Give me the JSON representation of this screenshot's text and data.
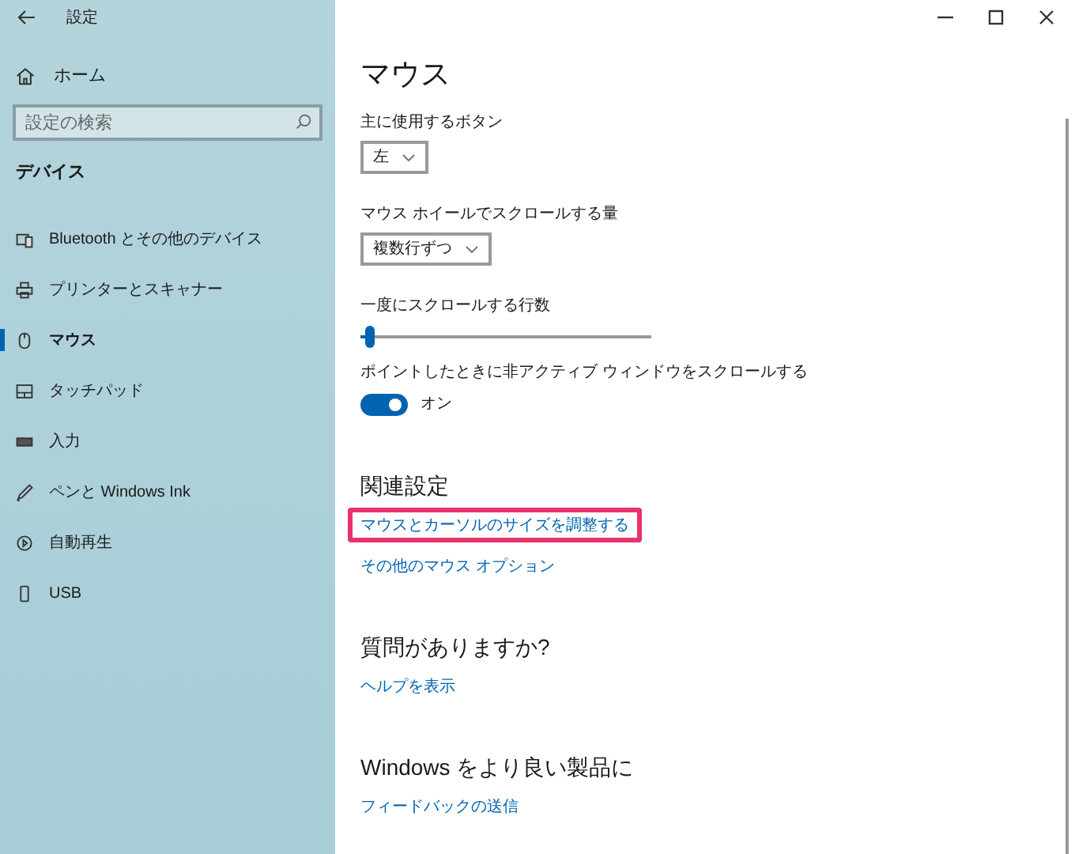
{
  "window": {
    "title": "設定"
  },
  "sidebar": {
    "home": "ホーム",
    "search": {
      "placeholder": "設定の検索"
    },
    "section": "デバイス",
    "items": [
      {
        "label": "Bluetooth とその他のデバイス",
        "kind": "bluetooth",
        "selected": false
      },
      {
        "label": "プリンターとスキャナー",
        "kind": "printer",
        "selected": false
      },
      {
        "label": "マウス",
        "kind": "mouse",
        "selected": true
      },
      {
        "label": "タッチパッド",
        "kind": "touchpad",
        "selected": false
      },
      {
        "label": "入力",
        "kind": "keyboard",
        "selected": false
      },
      {
        "label": "ペンと Windows Ink",
        "kind": "pen",
        "selected": false
      },
      {
        "label": "自動再生",
        "kind": "autoplay",
        "selected": false
      },
      {
        "label": "USB",
        "kind": "usb",
        "selected": false
      }
    ]
  },
  "main": {
    "title": "マウス",
    "settings": [
      {
        "kind": "dropdown",
        "label": "主に使用するボタン",
        "value": "左"
      },
      {
        "kind": "dropdown",
        "label": "マウス ホイールでスクロールする量",
        "value": "複数行ずつ"
      },
      {
        "kind": "slider",
        "label": "一度にスクロールする行数",
        "level": 0.03
      },
      {
        "kind": "toggle",
        "label": "ポイントしたときに非アクティブ ウィンドウをスクロールする",
        "on": true,
        "state_text": "オン"
      }
    ],
    "sections": [
      {
        "heading": "関連設定",
        "links": [
          {
            "label": "マウスとカーソルのサイズを調整する",
            "highlighted": true
          },
          {
            "label": "その他のマウス オプション",
            "highlighted": false
          }
        ]
      },
      {
        "heading": "質問がありますか?",
        "links": [
          {
            "label": "ヘルプを表示",
            "highlighted": false
          }
        ]
      },
      {
        "heading": "Windows をより良い製品に",
        "links": [
          {
            "label": "フィードバックの送信",
            "highlighted": false
          }
        ]
      }
    ]
  }
}
